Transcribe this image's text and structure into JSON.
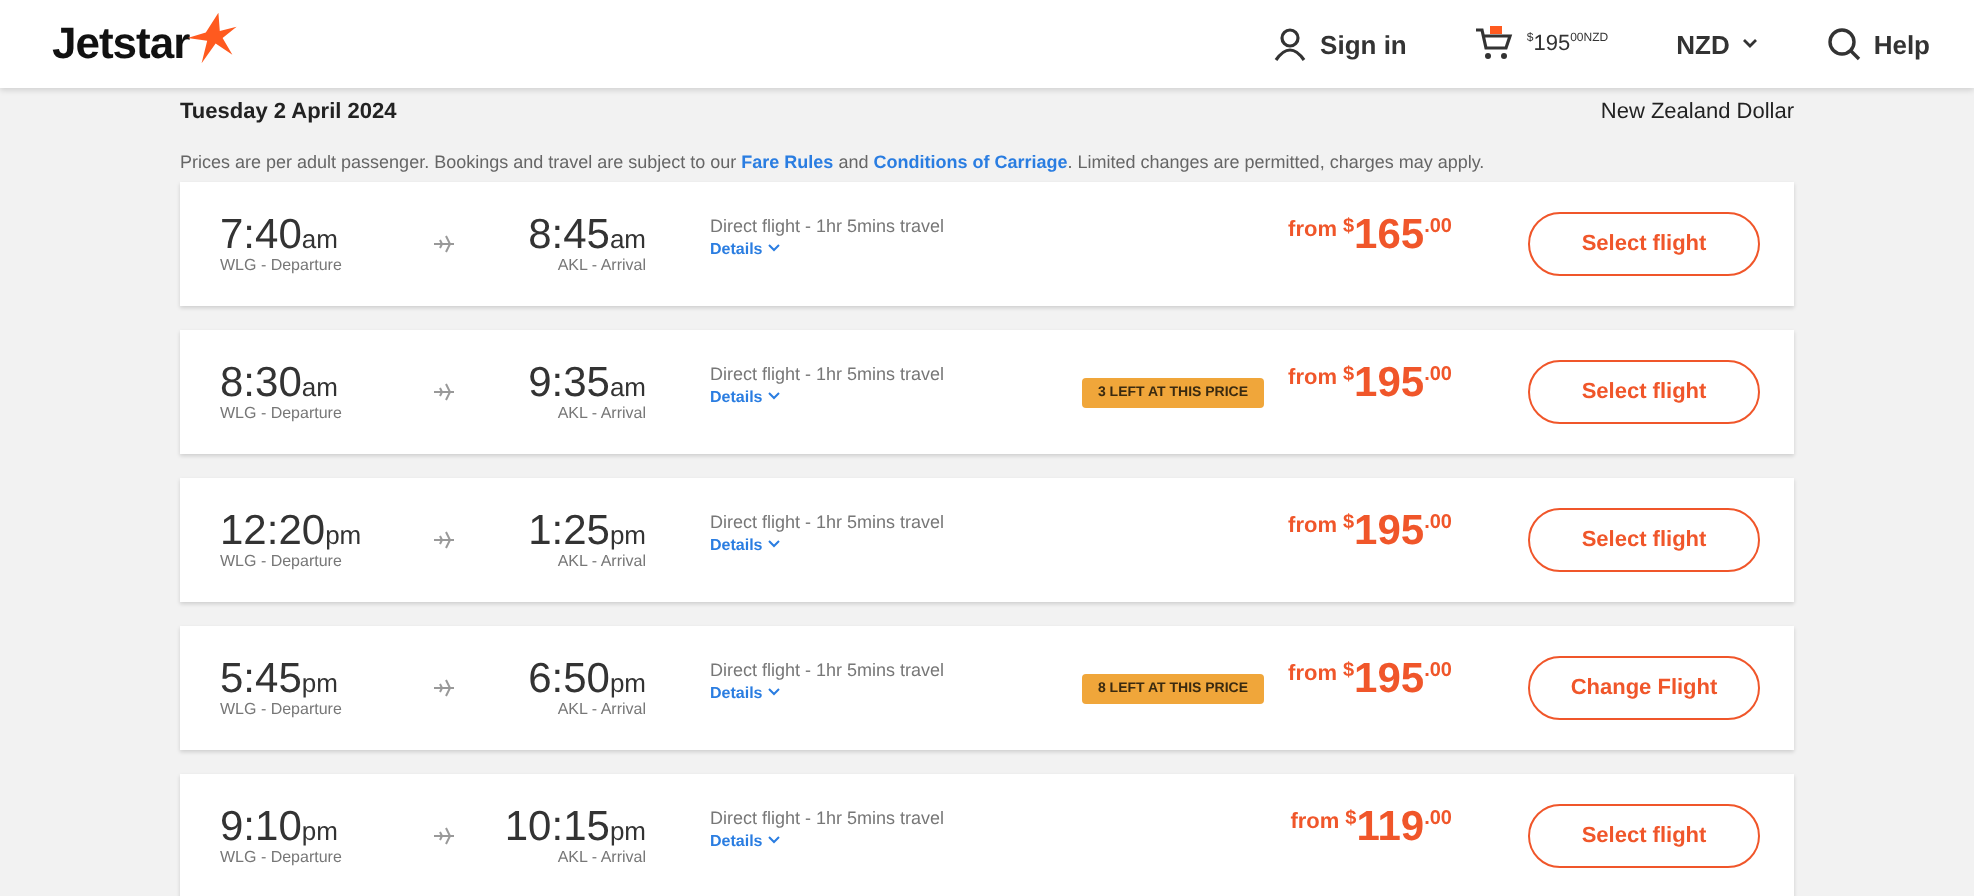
{
  "header": {
    "logo": "Jetstar",
    "sign_in": "Sign in",
    "cart": {
      "sign": "$",
      "amount": "195",
      "suffix": "00NZD"
    },
    "currency": "NZD",
    "help": "Help"
  },
  "date": "Tuesday 2 April 2024",
  "currency_name": "New Zealand Dollar",
  "notice": [
    {
      "kind": "text",
      "text": "Prices are per adult passenger. Bookings and travel are subject to our "
    },
    {
      "kind": "link",
      "text": "Fare Rules"
    },
    {
      "kind": "text",
      "text": " and "
    },
    {
      "kind": "link",
      "text": "Conditions of Carriage"
    },
    {
      "kind": "text",
      "text": ". Limited changes are permitted, charges may apply."
    }
  ],
  "flights": [
    {
      "dep_time": "7:40",
      "dep_ampm": "am",
      "dep_label": "WLG - Departure",
      "arr_time": "8:45",
      "arr_ampm": "am",
      "arr_label": "AKL - Arrival",
      "info": "Direct flight - 1hr 5mins travel",
      "details": "Details",
      "from": "from",
      "sign": "$",
      "price": "165",
      "cents": ".00",
      "button": "Select flight"
    },
    {
      "dep_time": "8:30",
      "dep_ampm": "am",
      "dep_label": "WLG - Departure",
      "arr_time": "9:35",
      "arr_ampm": "am",
      "arr_label": "AKL - Arrival",
      "info": "Direct flight - 1hr 5mins travel",
      "details": "Details",
      "badge": "3 LEFT AT THIS PRICE",
      "from": "from",
      "sign": "$",
      "price": "195",
      "cents": ".00",
      "button": "Select flight"
    },
    {
      "dep_time": "12:20",
      "dep_ampm": "pm",
      "dep_label": "WLG - Departure",
      "arr_time": "1:25",
      "arr_ampm": "pm",
      "arr_label": "AKL - Arrival",
      "info": "Direct flight - 1hr 5mins travel",
      "details": "Details",
      "from": "from",
      "sign": "$",
      "price": "195",
      "cents": ".00",
      "button": "Select flight"
    },
    {
      "dep_time": "5:45",
      "dep_ampm": "pm",
      "dep_label": "WLG - Departure",
      "arr_time": "6:50",
      "arr_ampm": "pm",
      "arr_label": "AKL - Arrival",
      "info": "Direct flight - 1hr 5mins travel",
      "details": "Details",
      "badge": "8 LEFT AT THIS PRICE",
      "from": "from",
      "sign": "$",
      "price": "195",
      "cents": ".00",
      "button": "Change Flight"
    },
    {
      "dep_time": "9:10",
      "dep_ampm": "pm",
      "dep_label": "WLG - Departure",
      "arr_time": "10:15",
      "arr_ampm": "pm",
      "arr_label": "AKL - Arrival",
      "info": "Direct flight - 1hr 5mins travel",
      "details": "Details",
      "from": "from",
      "sign": "$",
      "price": "119",
      "cents": ".00",
      "button": "Select flight"
    }
  ]
}
